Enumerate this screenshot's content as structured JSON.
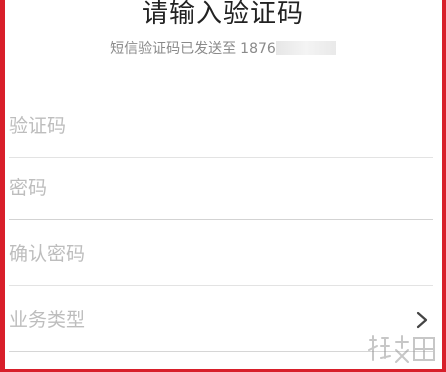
{
  "header": {
    "title": "请输入验证码",
    "subtitle_prefix": "短信验证码已发送至",
    "phone_visible": "1876"
  },
  "form": {
    "code_placeholder": "验证码",
    "password_placeholder": "密码",
    "confirm_password_placeholder": "确认密码",
    "business_type_label": "业务类型"
  },
  "icons": {
    "chevron": "chevron-right-icon",
    "watermark": "site-watermark-logo"
  },
  "colors": {
    "frame": "#d81f2a",
    "placeholder": "#bdbdbd",
    "divider": "#e3e3e3"
  },
  "watermark_text": "游侠网"
}
